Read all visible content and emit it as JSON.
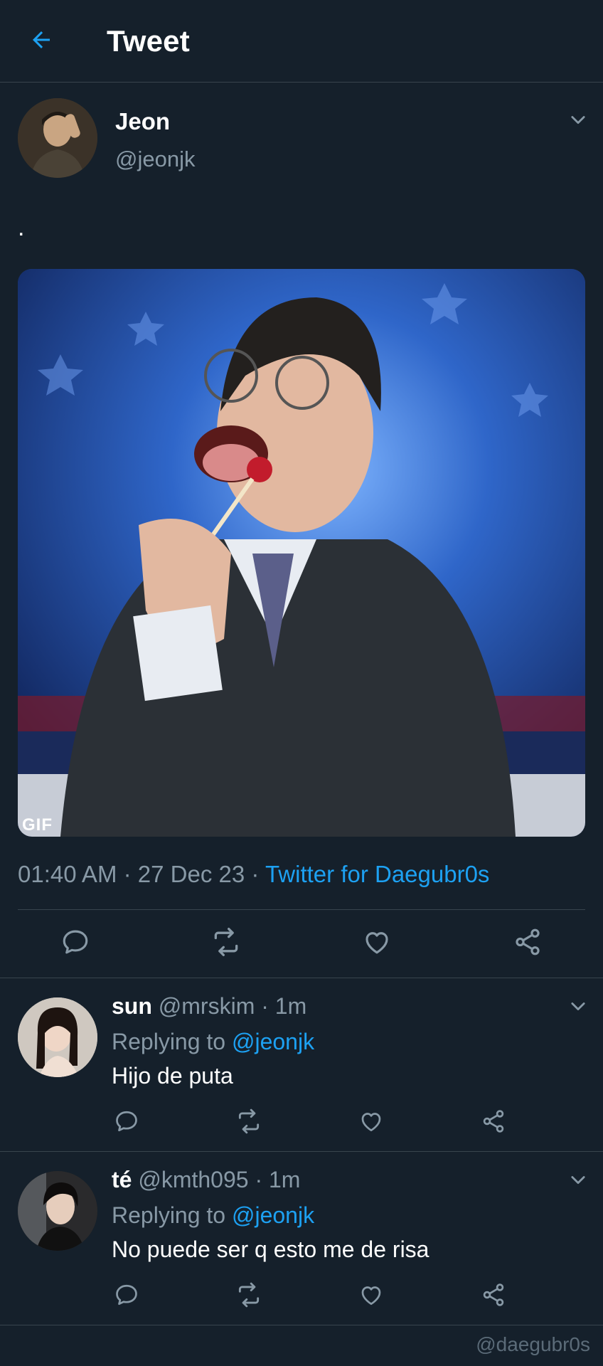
{
  "header": {
    "title": "Tweet",
    "back_icon": "arrow-left-icon"
  },
  "tweet": {
    "author_name": "Jeon",
    "author_handle": "@jeonjk",
    "text": ".",
    "media": {
      "type": "gif",
      "badge": "GIF"
    },
    "time": "01:40 AM",
    "date": "27 Dec 23",
    "separator": "·",
    "source": "Twitter for Daegubr0s",
    "actions": [
      "reply-icon",
      "retweet-icon",
      "like-icon",
      "share-icon"
    ]
  },
  "replies": [
    {
      "name": "sun",
      "handle": "@mrskim",
      "time": "· 1m",
      "replying_label": "Replying to",
      "replying_to": "@jeonjk",
      "text": "Hijo de puta"
    },
    {
      "name": "té",
      "handle": "@kmth095",
      "time": "· 1m",
      "replying_label": "Replying to",
      "replying_to": "@jeonjk",
      "text": "No puede ser q esto me de risa"
    }
  ],
  "watermark": "@daegubr0s",
  "colors": {
    "background": "#15202b",
    "divider": "#38444d",
    "accent": "#1da1f2",
    "secondary_text": "#8899a6"
  }
}
